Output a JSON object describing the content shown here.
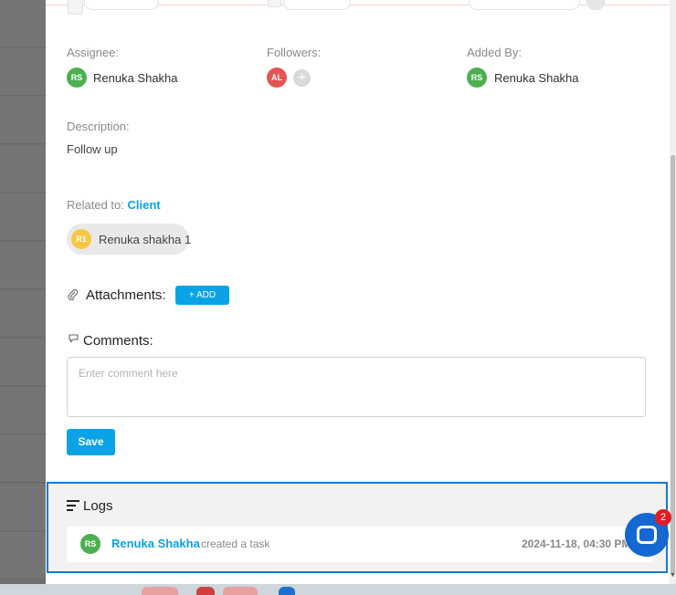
{
  "assignee": {
    "label": "Assignee:",
    "initials": "RS",
    "name": "Renuka Shakha"
  },
  "followers": {
    "label": "Followers:",
    "initials": "AL",
    "add_symbol": "+"
  },
  "added_by": {
    "label": "Added By:",
    "initials": "RS",
    "name": "Renuka Shakha"
  },
  "description": {
    "label": "Description:",
    "text": "Follow up"
  },
  "related": {
    "label": "Related to:",
    "type": "Client",
    "chip_initials": "R1",
    "chip_name": "Renuka shakha 1"
  },
  "attachments": {
    "title": "Attachments:",
    "add_label": "+ ADD"
  },
  "comments": {
    "title": "Comments:",
    "placeholder": "Enter comment here",
    "save_label": "Save"
  },
  "logs": {
    "title": "Logs",
    "entries": [
      {
        "initials": "RS",
        "user": "Renuka Shakha",
        "action": "created a task",
        "date": "2024-11-18, 04:30 PM"
      }
    ]
  },
  "chat": {
    "badge_count": "2"
  },
  "icons": {
    "attachments": "paperclip-icon",
    "comments": "speech-bubble-icon",
    "logs": "list-lines-icon",
    "chat": "chat-bubble-icon"
  },
  "colors": {
    "accent": "#0aa3e6",
    "avatar_green": "#4caf50",
    "avatar_red": "#e25555",
    "avatar_yellow": "#f7c744",
    "logs_border": "#1479d4",
    "chat_button": "#1567d1",
    "badge": "#e41b23"
  }
}
